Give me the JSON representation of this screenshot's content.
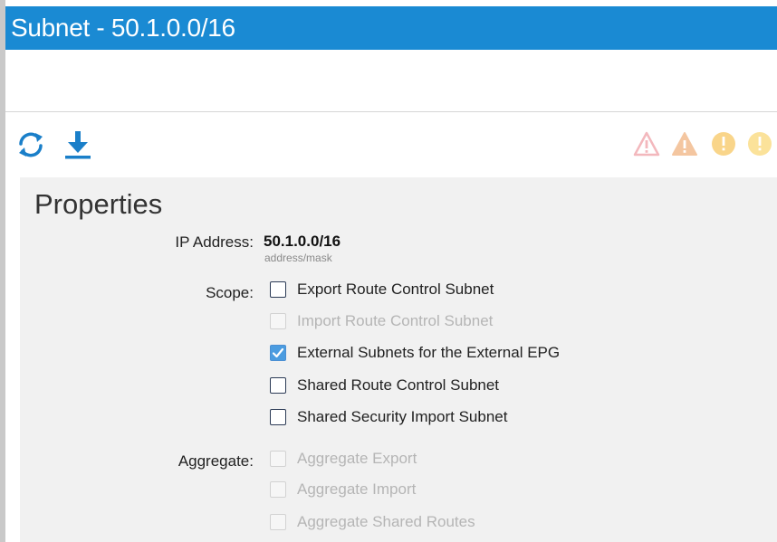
{
  "window": {
    "title": "Subnet - 50.1.0.0/16"
  },
  "toolbar": {
    "icons": [
      "refresh-icon",
      "download-icon"
    ],
    "fault_icons": [
      "critical-fault-icon",
      "major-fault-icon",
      "minor-fault-icon",
      "warning-fault-icon"
    ],
    "colors": {
      "critical": "#f3b8bd",
      "major": "#f4c6a0",
      "minor": "#f9d58a",
      "warning": "#fbe29a",
      "accent": "#1a8ad3"
    }
  },
  "properties": {
    "heading": "Properties",
    "ip_address": {
      "label": "IP Address:",
      "value": "50.1.0.0/16",
      "hint": "address/mask"
    },
    "scope": {
      "label": "Scope:",
      "options": [
        {
          "label": "Export Route Control Subnet",
          "checked": false,
          "disabled": false
        },
        {
          "label": "Import Route Control Subnet",
          "checked": false,
          "disabled": true
        },
        {
          "label": "External Subnets for the External EPG",
          "checked": true,
          "disabled": false
        },
        {
          "label": "Shared Route Control Subnet",
          "checked": false,
          "disabled": false
        },
        {
          "label": "Shared Security Import Subnet",
          "checked": false,
          "disabled": false
        }
      ]
    },
    "aggregate": {
      "label": "Aggregate:",
      "options": [
        {
          "label": "Aggregate Export",
          "checked": false,
          "disabled": true
        },
        {
          "label": "Aggregate Import",
          "checked": false,
          "disabled": true
        },
        {
          "label": "Aggregate Shared Routes",
          "checked": false,
          "disabled": true
        }
      ]
    }
  }
}
